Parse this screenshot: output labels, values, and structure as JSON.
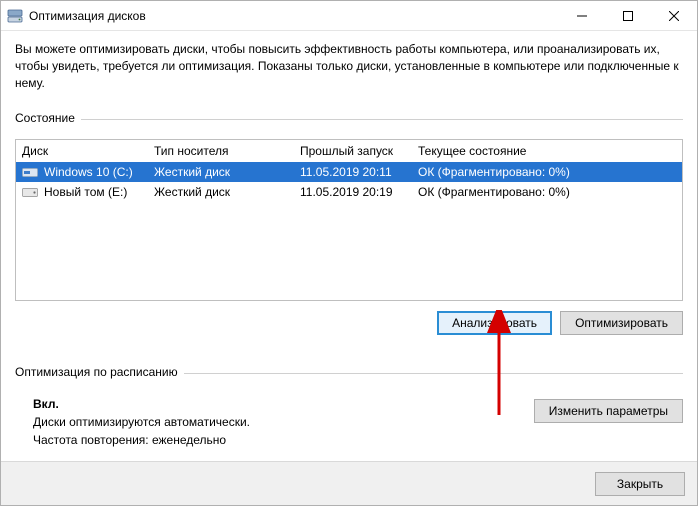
{
  "window": {
    "title": "Оптимизация дисков"
  },
  "intro": "Вы можете оптимизировать диски, чтобы повысить эффективность работы  компьютера, или проанализировать их, чтобы увидеть, требуется ли оптимизация. Показаны только диски, установленные в компьютере или подключенные к нему.",
  "status_label": "Состояние",
  "table": {
    "headers": {
      "disk": "Диск",
      "media": "Тип носителя",
      "last": "Прошлый запуск",
      "state": "Текущее состояние"
    },
    "rows": [
      {
        "disk": "Windows 10 (C:)",
        "media": "Жесткий диск",
        "last": "11.05.2019 20:11",
        "state": "ОК (Фрагментировано: 0%)",
        "selected": true
      },
      {
        "disk": "Новый том (E:)",
        "media": "Жесткий диск",
        "last": "11.05.2019 20:19",
        "state": "ОК (Фрагментировано: 0%)",
        "selected": false
      }
    ]
  },
  "actions": {
    "analyze": "Анализировать",
    "optimize": "Оптимизировать"
  },
  "schedule": {
    "title": "Оптимизация по расписанию",
    "on": "Вкл.",
    "auto": "Диски оптимизируются автоматически.",
    "freq": "Частота повторения: еженедельно",
    "change": "Изменить параметры"
  },
  "footer": {
    "close": "Закрыть"
  }
}
